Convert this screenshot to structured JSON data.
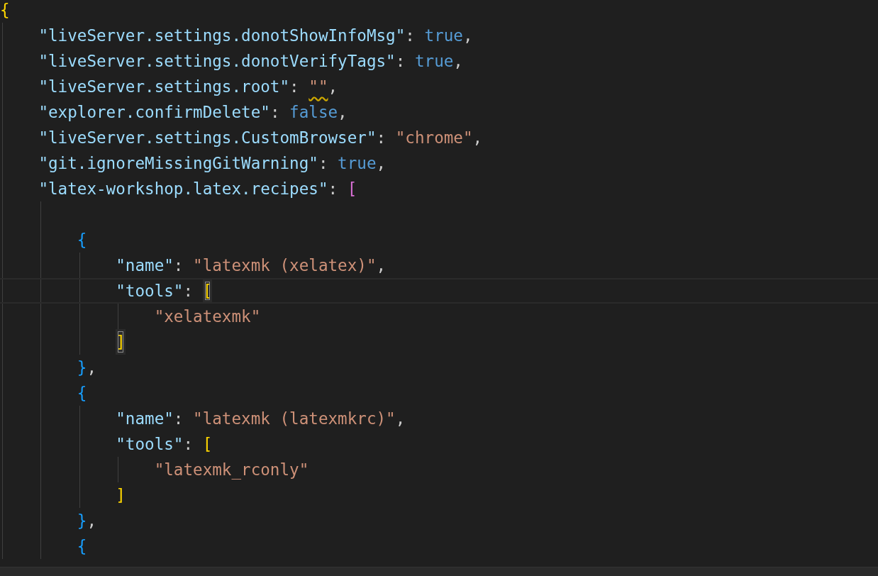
{
  "editor": {
    "lines": [
      {
        "tokens": [
          {
            "kind": "bracket",
            "text": "{",
            "color": "#ffd700"
          }
        ],
        "children": [
          {
            "tokens": [
              {
                "kind": "key",
                "text": "\"liveServer.settings.donotShowInfoMsg\""
              },
              {
                "kind": "punct",
                "text": ": "
              },
              {
                "kind": "bool",
                "text": "true"
              },
              {
                "kind": "punct",
                "text": ","
              }
            ]
          },
          {
            "tokens": [
              {
                "kind": "key",
                "text": "\"liveServer.settings.donotVerifyTags\""
              },
              {
                "kind": "punct",
                "text": ": "
              },
              {
                "kind": "bool",
                "text": "true"
              },
              {
                "kind": "punct",
                "text": ","
              }
            ]
          },
          {
            "tokens": [
              {
                "kind": "key",
                "text": "\"liveServer.settings.root\""
              },
              {
                "kind": "punct",
                "text": ": "
              },
              {
                "kind": "string",
                "text": "\"\"",
                "warning": true
              },
              {
                "kind": "punct",
                "text": ","
              }
            ]
          },
          {
            "tokens": [
              {
                "kind": "key",
                "text": "\"explorer.confirmDelete\""
              },
              {
                "kind": "punct",
                "text": ": "
              },
              {
                "kind": "bool",
                "text": "false"
              },
              {
                "kind": "punct",
                "text": ","
              }
            ]
          },
          {
            "tokens": [
              {
                "kind": "key",
                "text": "\"liveServer.settings.CustomBrowser\""
              },
              {
                "kind": "punct",
                "text": ": "
              },
              {
                "kind": "string",
                "text": "\"chrome\""
              },
              {
                "kind": "punct",
                "text": ","
              }
            ]
          },
          {
            "tokens": [
              {
                "kind": "key",
                "text": "\"git.ignoreMissingGitWarning\""
              },
              {
                "kind": "punct",
                "text": ": "
              },
              {
                "kind": "bool",
                "text": "true"
              },
              {
                "kind": "punct",
                "text": ","
              }
            ]
          },
          {
            "tokens": [
              {
                "kind": "key",
                "text": "\"latex-workshop.latex.recipes\""
              },
              {
                "kind": "punct",
                "text": ": "
              },
              {
                "kind": "bracket",
                "text": "[",
                "color": "#da70d6"
              }
            ],
            "children": [
              {
                "kind": "blank"
              },
              {
                "tokens": [
                  {
                    "kind": "bracket",
                    "text": "{",
                    "color": "#179fff"
                  }
                ],
                "children": [
                  {
                    "tokens": [
                      {
                        "kind": "key",
                        "text": "\"name\""
                      },
                      {
                        "kind": "punct",
                        "text": ": "
                      },
                      {
                        "kind": "string",
                        "text": "\"latexmk (xelatex)\""
                      },
                      {
                        "kind": "punct",
                        "text": ","
                      }
                    ]
                  },
                  {
                    "current": true,
                    "tokens": [
                      {
                        "kind": "key",
                        "text": "\"tools\""
                      },
                      {
                        "kind": "punct",
                        "text": ": "
                      },
                      {
                        "kind": "bracket",
                        "text": "[",
                        "color": "#ffd700",
                        "matched": true
                      }
                    ],
                    "children": [
                      {
                        "tokens": [
                          {
                            "kind": "string",
                            "text": "\"xelatexmk\""
                          }
                        ]
                      }
                    ]
                  },
                  {
                    "tokens": [
                      {
                        "kind": "bracket",
                        "text": "]",
                        "color": "#ffd700",
                        "matched": true
                      }
                    ]
                  }
                ]
              },
              {
                "tokens": [
                  {
                    "kind": "bracket",
                    "text": "}",
                    "color": "#179fff"
                  },
                  {
                    "kind": "punct",
                    "text": ","
                  }
                ]
              },
              {
                "tokens": [
                  {
                    "kind": "bracket",
                    "text": "{",
                    "color": "#179fff"
                  }
                ],
                "children": [
                  {
                    "tokens": [
                      {
                        "kind": "key",
                        "text": "\"name\""
                      },
                      {
                        "kind": "punct",
                        "text": ": "
                      },
                      {
                        "kind": "string",
                        "text": "\"latexmk (latexmkrc)\""
                      },
                      {
                        "kind": "punct",
                        "text": ","
                      }
                    ]
                  },
                  {
                    "tokens": [
                      {
                        "kind": "key",
                        "text": "\"tools\""
                      },
                      {
                        "kind": "punct",
                        "text": ": "
                      },
                      {
                        "kind": "bracket",
                        "text": "[",
                        "color": "#ffd700"
                      }
                    ],
                    "children": [
                      {
                        "tokens": [
                          {
                            "kind": "string",
                            "text": "\"latexmk_rconly\""
                          }
                        ]
                      }
                    ]
                  },
                  {
                    "tokens": [
                      {
                        "kind": "bracket",
                        "text": "]",
                        "color": "#ffd700"
                      }
                    ]
                  }
                ]
              },
              {
                "tokens": [
                  {
                    "kind": "bracket",
                    "text": "}",
                    "color": "#179fff"
                  },
                  {
                    "kind": "punct",
                    "text": ","
                  }
                ]
              },
              {
                "tokens": [
                  {
                    "kind": "bracket",
                    "text": "{",
                    "color": "#179fff"
                  }
                ]
              }
            ]
          }
        ]
      }
    ]
  }
}
